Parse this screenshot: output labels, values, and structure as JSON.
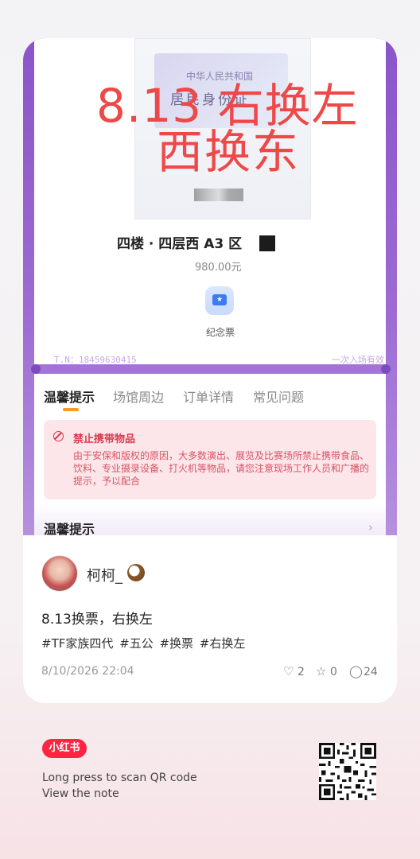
{
  "ticket": {
    "id_card_line1": "中华人民共和国",
    "id_card_line2": "居民身份证",
    "overlay_line1": "8.13 右换左",
    "overlay_line2": "西换东",
    "seat": "四楼 · 四层西 A3 区",
    "price": "980.00元",
    "souvenir_label": "纪念票",
    "tn": "T.N：18459630415",
    "validity": "一次入场有效"
  },
  "tabs": [
    {
      "label": "温馨提示",
      "active": true
    },
    {
      "label": "场馆周边",
      "active": false
    },
    {
      "label": "订单详情",
      "active": false
    },
    {
      "label": "常见问题",
      "active": false
    }
  ],
  "alert": {
    "title": "禁止携带物品",
    "body": "由于安保和版权的原因，大多数演出、展览及比赛场所禁止携带食品、饮料、专业摄录设备、打火机等物品，请您注意现场工作人员和广播的提示，予以配合"
  },
  "warm_tip_row": "温馨提示",
  "post": {
    "username": "柯柯_",
    "title": "8.13换票，右换左",
    "hashtags": "#TF家族四代 #五公 #换票 #右换左",
    "date": "8/10/2026 22:04",
    "likes": "2",
    "favorites": "0",
    "comments": "24"
  },
  "footer": {
    "brand": "小红书",
    "line1": "Long press to scan QR code",
    "line2": "View the note"
  },
  "colors": {
    "accent_red": "#ef4848",
    "brand_red": "#ff2442",
    "ticket_purple": "#8a55c9",
    "tab_indicator": "#f59a23"
  }
}
